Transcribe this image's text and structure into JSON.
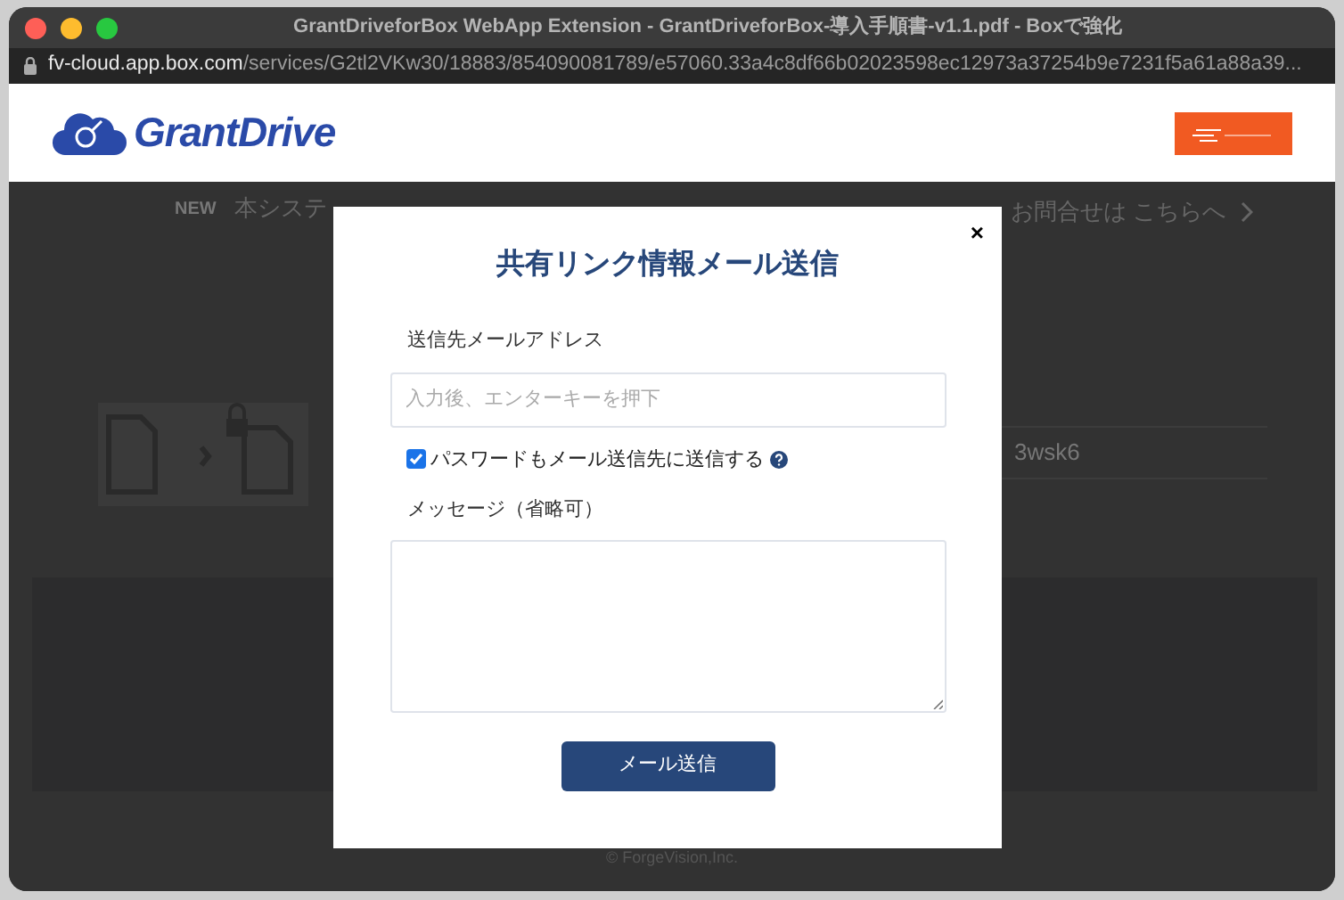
{
  "window": {
    "title": "GrantDriveforBox WebApp Extension - GrantDriveforBox-導入手順書-v1.1.pdf - Boxで強化"
  },
  "address_bar": {
    "host": "fv-cloud.app.box.com",
    "path": "/services/G2tl2VKw30/18883/854090081789/e57060.33a4c8df66b02023598ec12973a37254b9e7231f5a61a88a39..."
  },
  "header": {
    "logo_text": "GrantDrive"
  },
  "notice": {
    "badge": "NEW",
    "text_left": "本システ",
    "text_right": "お問合せは こちらへ"
  },
  "background": {
    "link_value": "3wsk6",
    "footer": "© ForgeVision,Inc."
  },
  "dialog": {
    "title": "共有リンク情報メール送信",
    "close": "×",
    "email_label": "送信先メールアドレス",
    "email_field": {
      "placeholder": "入力後、エンターキーを押下"
    },
    "send_password": {
      "label": "パスワードもメール送信先に送信する",
      "checked": true
    },
    "message_label": "メッセージ（省略可）",
    "send_button": "メール送信"
  }
}
